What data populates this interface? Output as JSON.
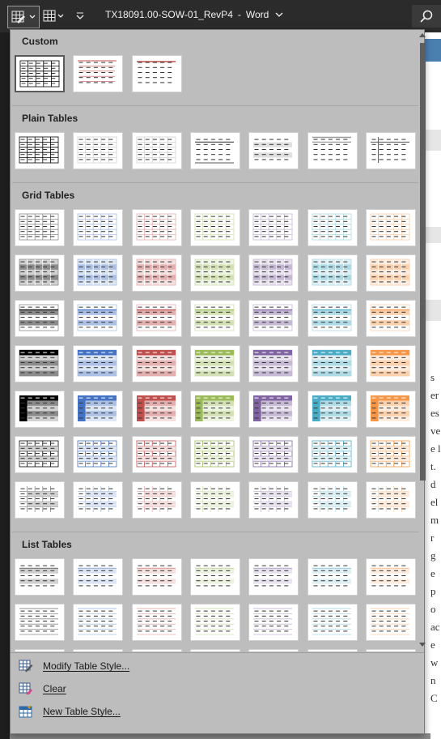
{
  "titlebar": {
    "doc_name": "TX18091.00-SOW-01_RevP4",
    "app_name": "Word",
    "separator": "-",
    "icons": [
      "table-style-icon",
      "chevron-down-icon",
      "table-grid-icon",
      "customize-qat-icon",
      "search-icon"
    ]
  },
  "background_doc": {
    "visible_letters": [
      "s",
      "er",
      "es",
      "ve",
      "e l",
      "t.",
      "d",
      "el",
      "m",
      "r g",
      "e",
      "p",
      "o",
      "ac",
      "e",
      "w",
      "n",
      "C"
    ]
  },
  "gallery": {
    "sections": [
      {
        "title": "Custom"
      },
      {
        "title": "Plain Tables"
      },
      {
        "title": "Grid Tables"
      },
      {
        "title": "List Tables"
      }
    ],
    "accent_colors": [
      "#000000",
      "#4472c4",
      "#c0504d",
      "#9bbb59",
      "#8064a2",
      "#4bacc6",
      "#f79646"
    ],
    "selected": "Custom style 1"
  },
  "menu": {
    "modify": "Modify Table Style...",
    "clear": "Clear",
    "new": "New Table Style..."
  }
}
